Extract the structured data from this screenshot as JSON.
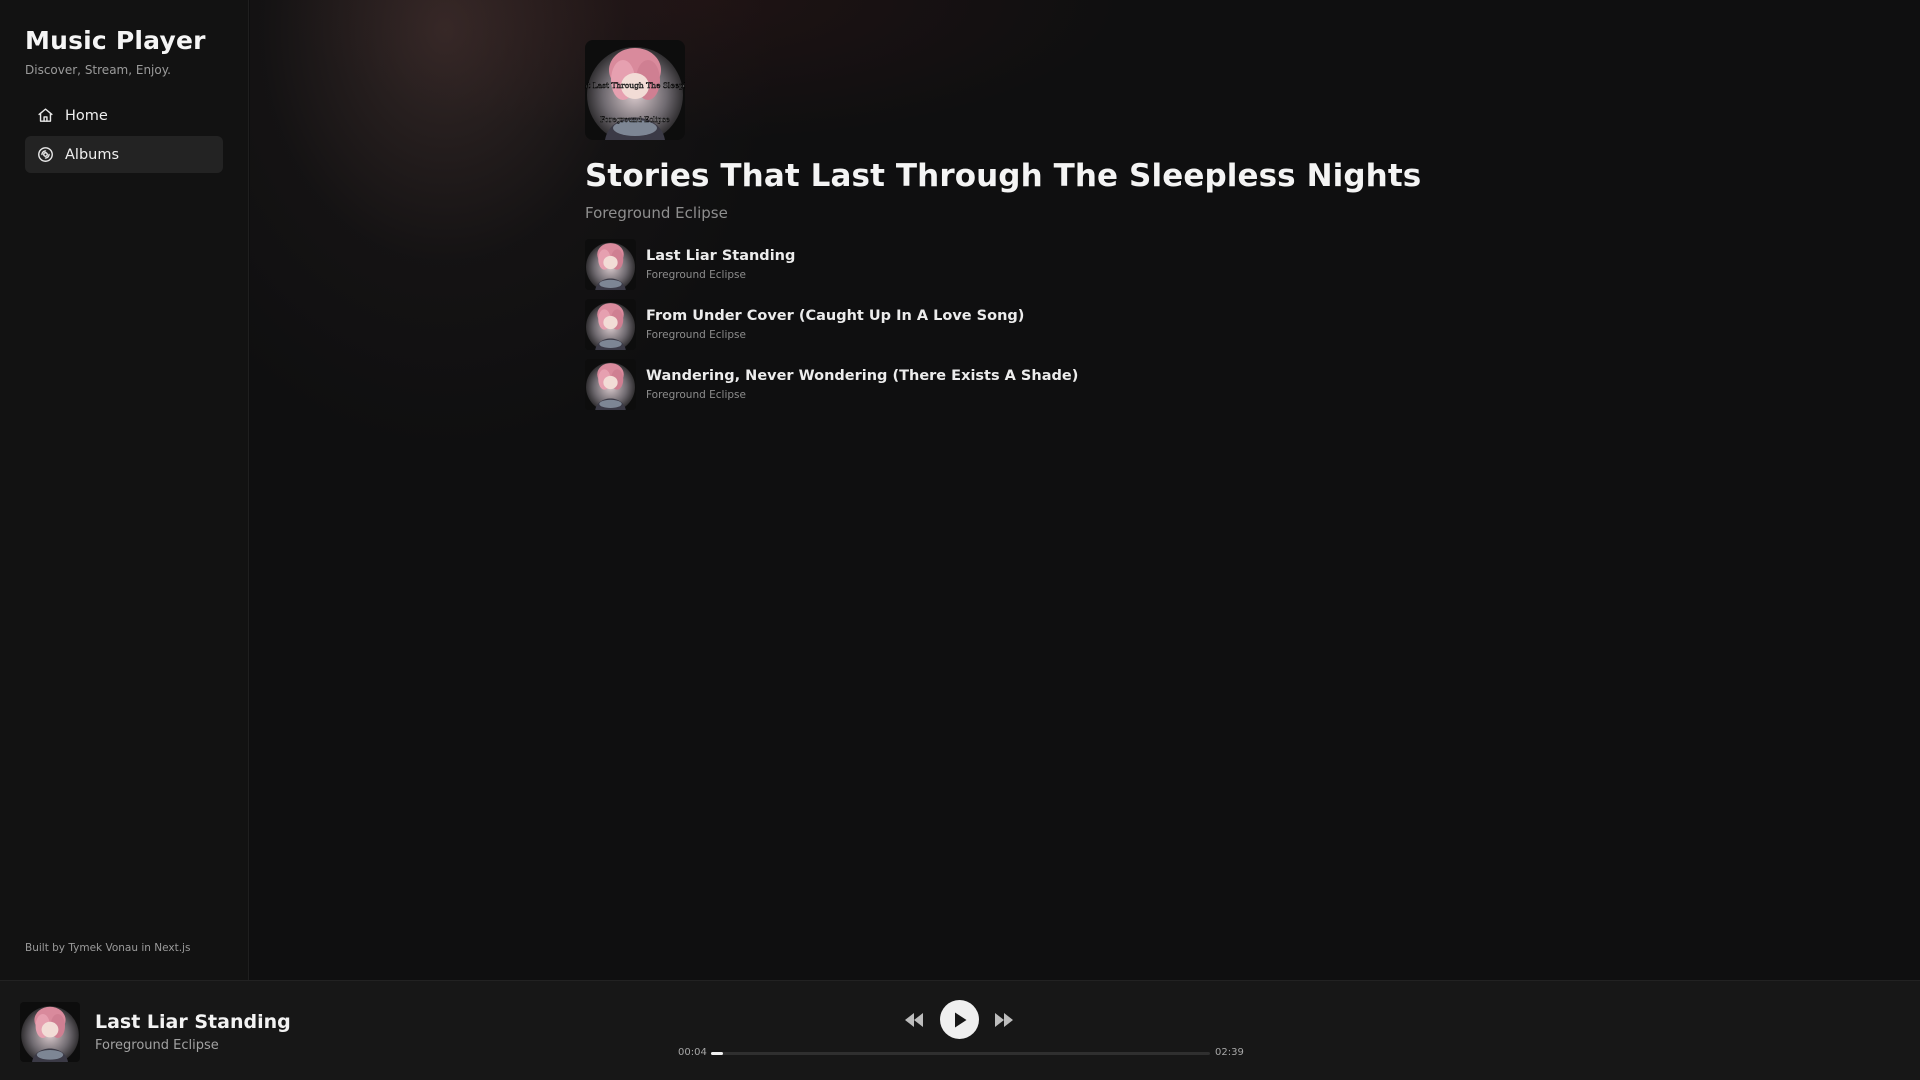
{
  "sidebar": {
    "title": "Music Player",
    "tagline": "Discover, Stream, Enjoy.",
    "nav": [
      {
        "label": "Home",
        "icon": "home-icon",
        "active": false
      },
      {
        "label": "Albums",
        "icon": "disc-icon",
        "active": true
      }
    ],
    "credit": "Built by Tymek Vonau in Next.js"
  },
  "album": {
    "title": "Stories That Last Through The Sleepless Nights",
    "artist": "Foreground Eclipse",
    "cover_text_top": "Stories That Last Through The Sleepless Nights",
    "cover_text_bottom": "Foreground Eclipse",
    "tracks": [
      {
        "title": "Last Liar Standing",
        "artist": "Foreground Eclipse"
      },
      {
        "title": "From Under Cover (Caught Up In A Love Song)",
        "artist": "Foreground Eclipse"
      },
      {
        "title": "Wandering, Never Wondering (There Exists A Shade)",
        "artist": "Foreground Eclipse"
      }
    ]
  },
  "player": {
    "title": "Last Liar Standing",
    "artist": "Foreground Eclipse",
    "current_time": "00:04",
    "total_time": "02:39",
    "progress": 0.025,
    "controls": [
      "rewind-icon",
      "play-icon",
      "fast-forward-icon"
    ]
  },
  "colors": {
    "background": "#0e0e0f",
    "sidebar": "#121212",
    "player_bar": "#171717",
    "accent": "#f0f0f0",
    "muted_text": "#8e8e8e"
  }
}
